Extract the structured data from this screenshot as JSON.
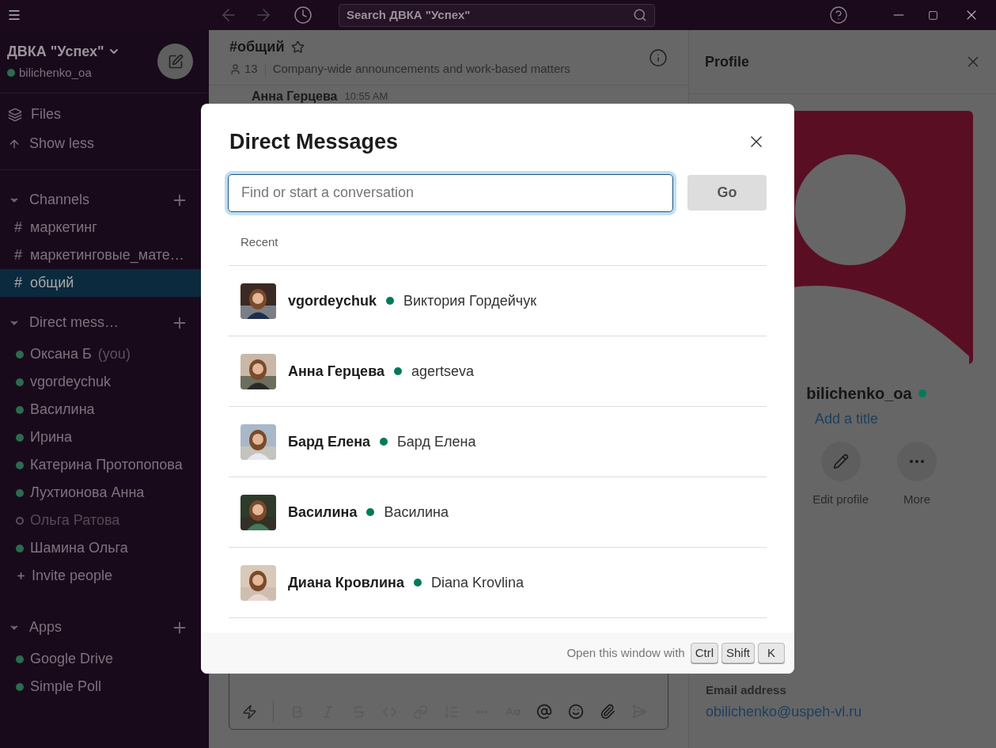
{
  "titlebar": {
    "search_placeholder": "Search ДВКА \"Успех\""
  },
  "workspace": {
    "name": "ДВКА \"Успех\"",
    "user": "bilichenko_oa",
    "online": true
  },
  "nav": [
    {
      "kind": "files",
      "label": "Files"
    },
    {
      "kind": "less",
      "label": "Show less"
    }
  ],
  "channels": {
    "title": "Channels",
    "items": [
      {
        "prefix": "#",
        "label": "маркетинг",
        "selected": false
      },
      {
        "prefix": "#",
        "label": "маркетинговые_мате…",
        "selected": false
      },
      {
        "prefix": "#",
        "label": "общий",
        "selected": true
      }
    ]
  },
  "direct_messages": {
    "title": "Direct mess…",
    "items": [
      {
        "label": "Оксана Б",
        "suffix": "(you)",
        "online": true
      },
      {
        "label": "vgordeychuk",
        "online": true
      },
      {
        "label": "Василина",
        "online": true
      },
      {
        "label": "Ирина",
        "online": true
      },
      {
        "label": "Катерина Протопопова",
        "online": true
      },
      {
        "label": "Лухтионова Анна",
        "online": true
      },
      {
        "label": "Ольга Ратова",
        "online": false
      },
      {
        "label": "Шамина Ольга",
        "online": true
      }
    ],
    "invite": "Invite people"
  },
  "apps": {
    "title": "Apps",
    "items": [
      {
        "label": "Google Drive",
        "online": true
      },
      {
        "label": "Simple Poll",
        "online": true
      }
    ]
  },
  "channel_header": {
    "name": "#общий",
    "members": "13",
    "topic": "Company-wide announcements and work-based matters"
  },
  "message": {
    "author": "Анна Герцева",
    "time": "10:55 AM"
  },
  "profile": {
    "title": "Profile",
    "name": "bilichenko_oa",
    "online": true,
    "add_title": "Add a title",
    "actions": [
      {
        "kind": "edit",
        "label": "Edit profile"
      },
      {
        "kind": "more",
        "label": "More"
      }
    ],
    "email_label": "Email address",
    "email": "obilichenko@uspeh-vl.ru"
  },
  "modal": {
    "title": "Direct Messages",
    "placeholder": "Find or start a conversation",
    "go": "Go",
    "recent": "Recent",
    "rows": [
      {
        "name": "vgordeychuk",
        "detail": "Виктория Гордейчук",
        "online": true
      },
      {
        "name": "Анна Герцева",
        "detail": "agertseva",
        "online": true
      },
      {
        "name": "Бард Елена",
        "detail": "Бард Елена",
        "online": true
      },
      {
        "name": "Василина",
        "detail": "Василина",
        "online": true
      },
      {
        "name": "Диана Кровлина",
        "detail": "Diana Krovlina",
        "online": true
      }
    ],
    "hint": "Open this window with",
    "keys": [
      "Ctrl",
      "Shift",
      "K"
    ]
  }
}
